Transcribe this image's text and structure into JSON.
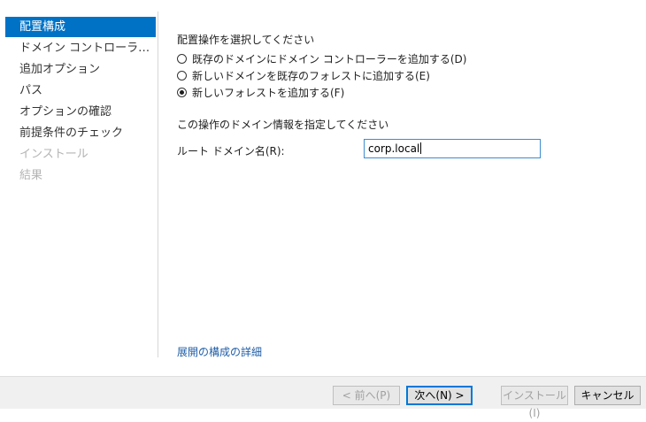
{
  "sidebar": {
    "items": [
      {
        "label": "配置構成",
        "state": "selected"
      },
      {
        "label": "ドメイン コントローラー オプシ...",
        "state": "normal"
      },
      {
        "label": "追加オプション",
        "state": "normal"
      },
      {
        "label": "パス",
        "state": "normal"
      },
      {
        "label": "オプションの確認",
        "state": "normal"
      },
      {
        "label": "前提条件のチェック",
        "state": "normal"
      },
      {
        "label": "インストール",
        "state": "disabled"
      },
      {
        "label": "結果",
        "state": "disabled"
      }
    ]
  },
  "main": {
    "deploy_op_label": "配置操作を選択してください",
    "options": [
      {
        "label": "既存のドメインにドメイン コントローラーを追加する(D)",
        "checked": false
      },
      {
        "label": "新しいドメインを既存のフォレストに追加する(E)",
        "checked": false
      },
      {
        "label": "新しいフォレストを追加する(F)",
        "checked": true
      }
    ],
    "domain_info_label": "この操作のドメイン情報を指定してください",
    "root_domain_label": "ルート ドメイン名(R):",
    "root_domain_value": "corp.local",
    "details_link": "展開の構成の詳細"
  },
  "footer": {
    "prev_label": "< 前へ(P)",
    "next_label": "次へ(N) >",
    "install_label": "インストール(I)",
    "cancel_label": "キャンセル"
  },
  "colors": {
    "accent": "#0072c6",
    "link": "#1f5ea8",
    "disabled_text": "#b4b4b4"
  }
}
